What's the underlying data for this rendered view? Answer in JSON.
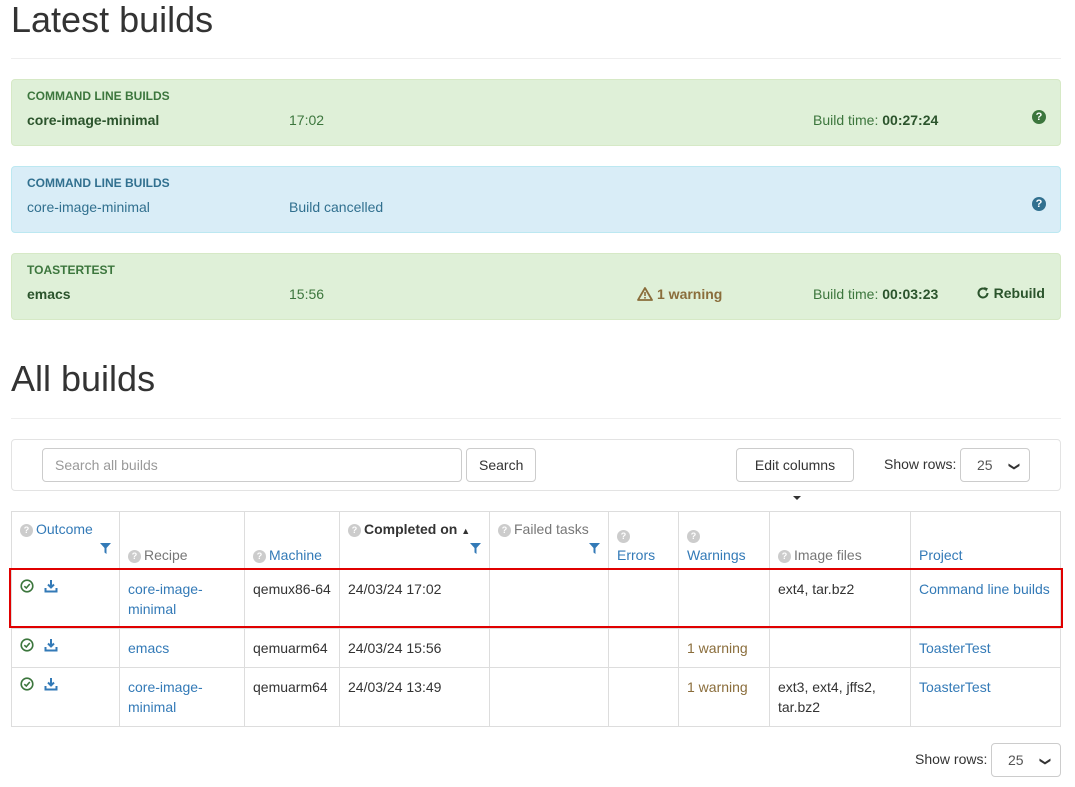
{
  "latest": {
    "title": "Latest builds",
    "cards": [
      {
        "project": "COMMAND LINE BUILDS",
        "target": "core-image-minimal",
        "time": "17:02",
        "build_time_label": "Build time:",
        "build_time": "00:27:24"
      },
      {
        "project": "COMMAND LINE BUILDS",
        "target": "core-image-minimal",
        "status": "Build cancelled"
      },
      {
        "project": "TOASTERTEST",
        "target": "emacs",
        "time": "15:56",
        "warning": "1 warning",
        "build_time_label": "Build time:",
        "build_time": "00:03:23",
        "rebuild": "Rebuild"
      }
    ]
  },
  "all": {
    "title": "All builds",
    "search_placeholder": "Search all builds",
    "search_button": "Search",
    "edit_columns": "Edit columns",
    "show_rows_label": "Show rows:",
    "show_rows_value": "25",
    "columns": [
      "Outcome",
      "Recipe",
      "Machine",
      "Completed on",
      "Failed tasks",
      "Errors",
      "Warnings",
      "Image files",
      "Project"
    ],
    "rows": [
      {
        "recipe": "core-image-minimal",
        "machine": "qemux86-64",
        "completed": "24/03/24 17:02",
        "failed": "",
        "errors": "",
        "warnings": "",
        "images": "ext4, tar.bz2",
        "project": "Command line builds"
      },
      {
        "recipe": "emacs",
        "machine": "qemuarm64",
        "completed": "24/03/24 15:56",
        "failed": "",
        "errors": "",
        "warnings": "1 warning",
        "images": "",
        "project": "ToasterTest"
      },
      {
        "recipe": "core-image-minimal",
        "machine": "qemuarm64",
        "completed": "24/03/24 13:49",
        "failed": "",
        "errors": "",
        "warnings": "1 warning",
        "images": "ext3, ext4, jffs2, tar.bz2",
        "project": "ToasterTest"
      }
    ]
  },
  "colors": {
    "success_bg": "#dff0d8",
    "info_bg": "#d9edf7",
    "link": "#337ab7",
    "warning": "#8a6d3b",
    "highlight": "#e00000"
  }
}
